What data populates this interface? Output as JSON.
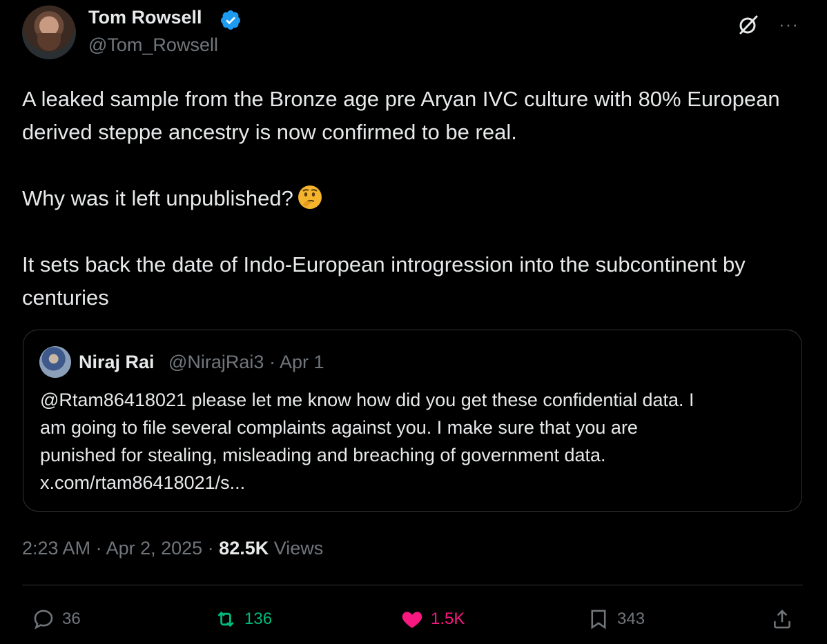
{
  "author": {
    "name": "Tom Rowsell",
    "handle": "@Tom_Rowsell",
    "verified": true
  },
  "header_icons": [
    "grok-icon",
    "more-icon"
  ],
  "more_label": "···",
  "tweet": {
    "paragraphs": [
      "A leaked sample from the Bronze age pre Aryan IVC culture with 80% European derived steppe ancestry is now confirmed to be real.",
      "Why was it left unpublished?",
      "It sets back the date of Indo-European introgression into the subcontinent by centuries"
    ],
    "emoji": "🤔"
  },
  "quote": {
    "name": "Niraj Rai",
    "meta": "@NirajRai3 · Apr 1",
    "lines": [
      "@Rtam86418021 please let me know how did you get these confidential data. I",
      "am going to file several complaints against you. I make sure that you are",
      "punished for stealing, misleading and breaching of government data.",
      "x.com/rtam86418021/s..."
    ]
  },
  "timestamp": {
    "datetime": "2:23 AM · Apr 2, 2025 · ",
    "views_count": "82.5K",
    "views_label": " Views"
  },
  "actions": {
    "reply": "36",
    "retweet": "136",
    "like": "1.5K",
    "bookmark": "343"
  },
  "colors": {
    "background": "#000000",
    "text": "#e7e9ea",
    "muted": "#71767b",
    "verified": "#1d9bf0",
    "retweet": "#00ba7c",
    "like": "#f91880",
    "border": "#2f3336"
  }
}
